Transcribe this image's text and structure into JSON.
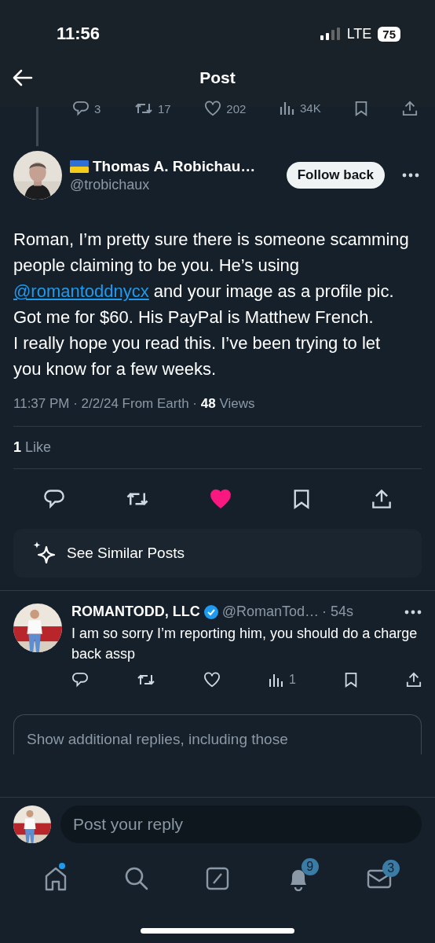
{
  "status_bar": {
    "time": "11:56",
    "network": "LTE",
    "battery": "75"
  },
  "header": {
    "title": "Post"
  },
  "previous_post_actions": [
    {
      "kind": "reply",
      "count": "3"
    },
    {
      "kind": "repost",
      "count": "17"
    },
    {
      "kind": "like",
      "count": "202"
    },
    {
      "kind": "views",
      "count": "34K"
    },
    {
      "kind": "bookmark"
    },
    {
      "kind": "share"
    }
  ],
  "post": {
    "author": "Thomas A. Robichau…",
    "handle": "@trobichaux",
    "follow_button": "Follow back",
    "body": [
      {
        "kind": "text",
        "text": "Roman, I’m pretty sure there is someone scamming people claiming to be you. He’s using "
      },
      {
        "kind": "link",
        "text": "@romantoddnycx"
      },
      {
        "kind": "text",
        "text": " and your image as a profile pic.\nGot me for $60. His PayPal is Matthew French.\nI really hope you read this. I’ve been trying to let you know for a few weeks."
      }
    ],
    "meta": "11:37 PM · 2/2/24 From Earth · **48** Views",
    "likes": "**1** Like",
    "actions": [
      {
        "kind": "reply",
        "active": false
      },
      {
        "kind": "repost",
        "active": false
      },
      {
        "kind": "like",
        "active": true
      },
      {
        "kind": "bookmark",
        "active": false
      },
      {
        "kind": "share",
        "active": false
      }
    ],
    "similar_button": "See Similar Posts"
  },
  "reply": {
    "author": "ROMANTODD, LLC",
    "verified": true,
    "handle": "@RomanTod…",
    "time": "· 54s",
    "text": "I am so sorry I’m reporting him, you should do a charge back assp",
    "actions": [
      {
        "kind": "reply"
      },
      {
        "kind": "repost"
      },
      {
        "kind": "like"
      },
      {
        "kind": "views",
        "count": "1"
      },
      {
        "kind": "bookmark"
      },
      {
        "kind": "share"
      }
    ]
  },
  "show_more": "Show additional replies, including those",
  "composer": {
    "placeholder": "Post your reply"
  },
  "tab_bar": [
    {
      "kind": "home",
      "dot": true
    },
    {
      "kind": "search"
    },
    {
      "kind": "compose"
    },
    {
      "kind": "notifications",
      "badge": "9"
    },
    {
      "kind": "messages",
      "badge": "3"
    }
  ]
}
